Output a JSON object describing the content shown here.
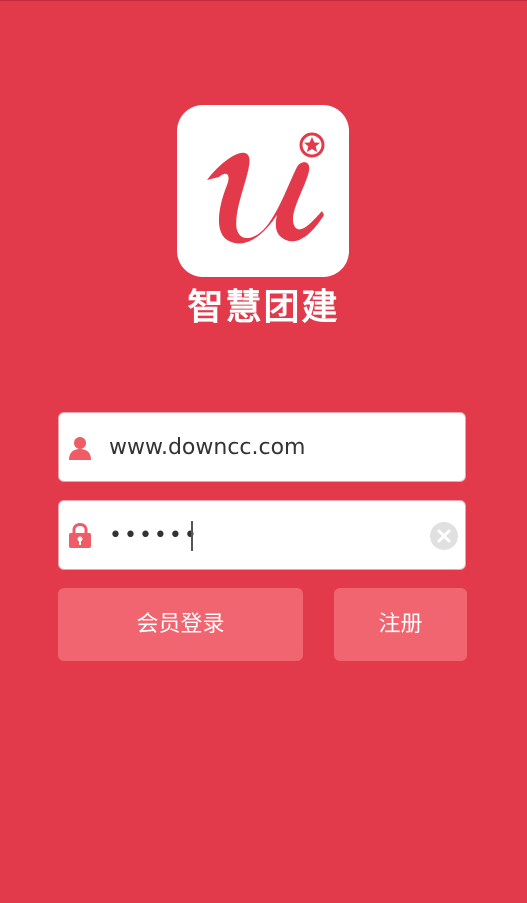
{
  "app": {
    "name": "智慧团建",
    "logo_letter": "u"
  },
  "login_form": {
    "username_value": "www.downcc.com",
    "password_masked": "••••••"
  },
  "buttons": {
    "login_label": "会员登录",
    "register_label": "注册"
  },
  "colors": {
    "background": "#e33a4b",
    "button": "#f0656f",
    "icon": "#ee5c66"
  },
  "icons": {
    "username": "user-icon",
    "password": "lock-icon",
    "clear": "clear-icon",
    "registered_mark": "star-registered-icon"
  }
}
